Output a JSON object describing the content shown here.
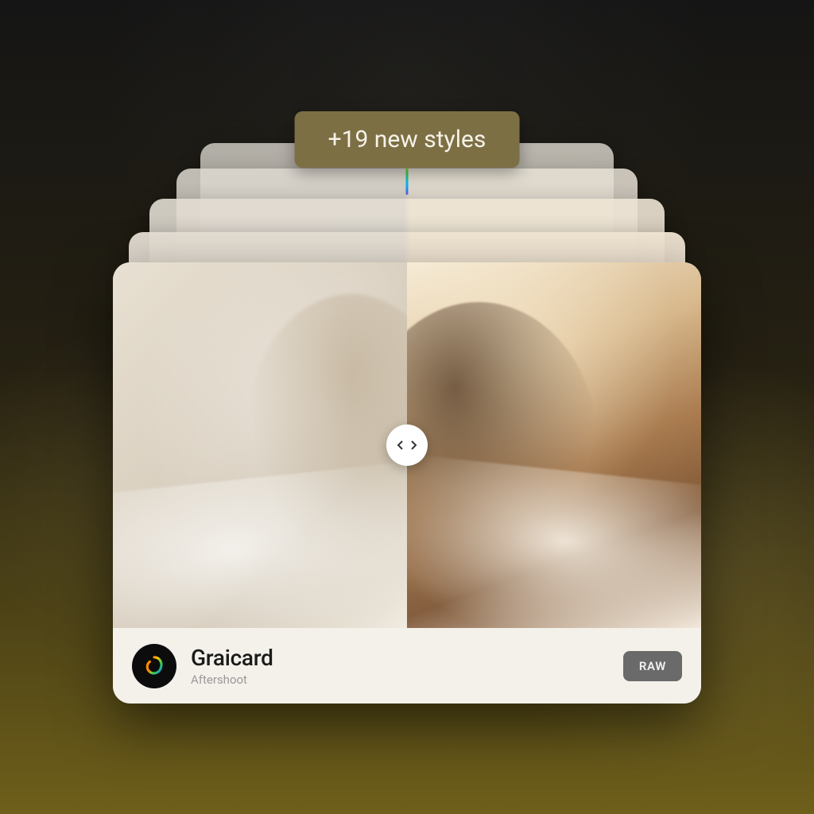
{
  "chip": {
    "label": "+19 new styles"
  },
  "card": {
    "title": "Graicard",
    "subtitle": "Aftershoot",
    "badge": "RAW"
  }
}
